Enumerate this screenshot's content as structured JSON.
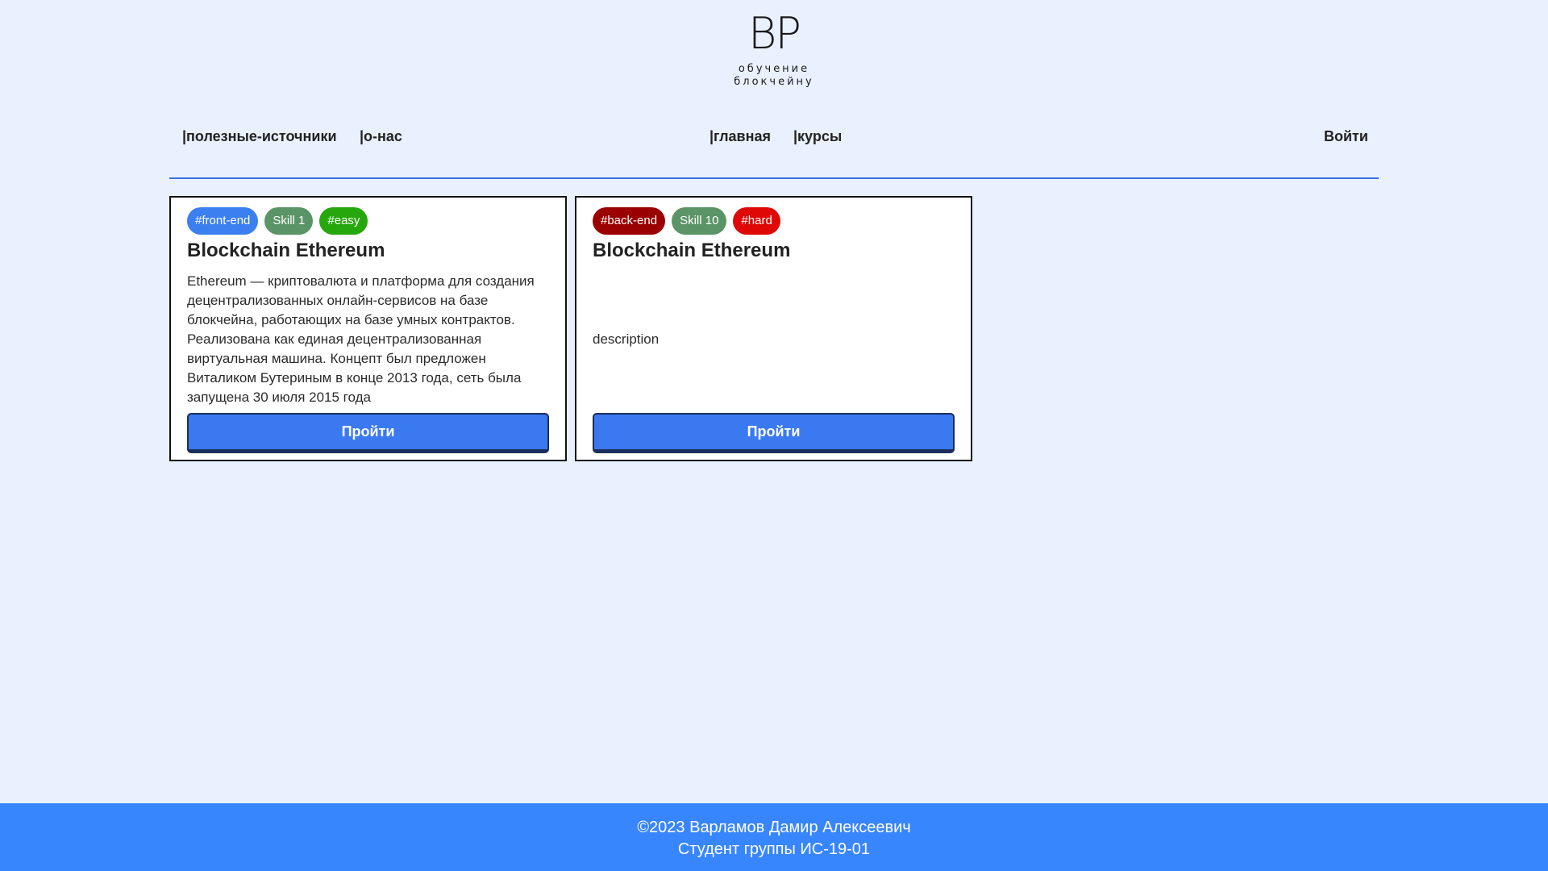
{
  "logo": {
    "mark": "ВР",
    "subtitle": "обучение блокчейну"
  },
  "nav": {
    "useful_sources": "|полезные-источники",
    "about": "|о-нас",
    "home": "|главная",
    "courses": "|курсы",
    "login": "Войти"
  },
  "courses": [
    {
      "badges": [
        {
          "label": "#front-end",
          "color": "#3b7ff0"
        },
        {
          "label": "Skill 1",
          "color": "#5b9467"
        },
        {
          "label": "#easy",
          "color": "#26a80c"
        }
      ],
      "title": "Blockchain Ethereum",
      "description": "Ethereum — криптовалюта и платформа для создания децентрализованных онлайн-сервисов на базе блокчейна, работающих на базе умных контрактов. Реализована как единая децентрализованная виртуальная машина. Концепт был предложен Виталиком Бутериным в конце 2013 года, сеть была запущена 30 июля 2015 года",
      "button": "Пройти"
    },
    {
      "badges": [
        {
          "label": "#back-end",
          "color": "#9b0000"
        },
        {
          "label": "Skill 10",
          "color": "#5b9467"
        },
        {
          "label": "#hard",
          "color": "#e00707"
        }
      ],
      "title": "Blockchain Ethereum",
      "description": "description",
      "button": "Пройти"
    }
  ],
  "footer": {
    "copyright": "©2023 Варламов Дамир Алексеевич",
    "group": "Студент группы ИС-19-01"
  }
}
